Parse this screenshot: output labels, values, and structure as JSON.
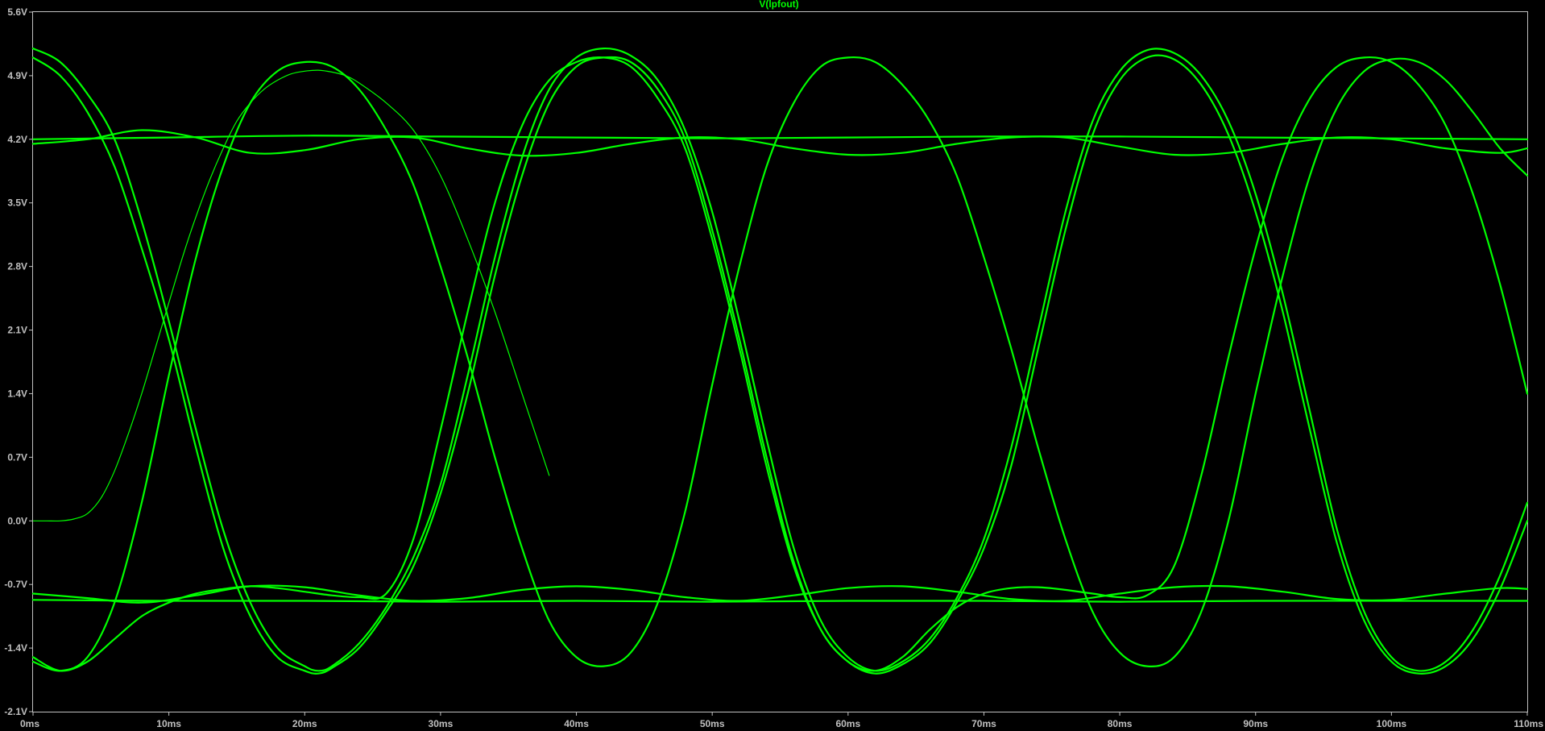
{
  "chart_data": {
    "type": "line",
    "title": "V(lpfout)",
    "xlabel": "",
    "ylabel": "",
    "x_unit": "ms",
    "y_unit": "V",
    "xlim": [
      0,
      110
    ],
    "ylim": [
      -2.1,
      5.6
    ],
    "x_ticks": [
      "0ms",
      "10ms",
      "20ms",
      "30ms",
      "40ms",
      "50ms",
      "60ms",
      "70ms",
      "80ms",
      "90ms",
      "100ms",
      "110ms"
    ],
    "y_ticks": [
      "5.6V",
      "4.9V",
      "4.2V",
      "3.5V",
      "2.8V",
      "2.1V",
      "1.4V",
      "0.7V",
      "0.0V",
      "-0.7V",
      "-1.4V",
      "-2.1V"
    ],
    "grid": false,
    "trace_color": "#00ff00",
    "background_color": "#000000",
    "series": [
      {
        "x": [
          0,
          2,
          4,
          6,
          8,
          10,
          12,
          14,
          16,
          18,
          20,
          21,
          22,
          24,
          26,
          28,
          30,
          32,
          34,
          36,
          38,
          40,
          42,
          44,
          46,
          48,
          50,
          52,
          54,
          56,
          58,
          60,
          62,
          64,
          66,
          68,
          70,
          72,
          74,
          76,
          78,
          80,
          82,
          84,
          86,
          88,
          90,
          92,
          94,
          96,
          98,
          100,
          102,
          104,
          106,
          108,
          110
        ],
        "y": [
          5.2,
          5.05,
          4.7,
          4.2,
          3.3,
          2.2,
          1.0,
          -0.1,
          -0.9,
          -1.4,
          -1.6,
          -1.65,
          -1.6,
          -1.35,
          -0.95,
          -0.4,
          0.4,
          1.6,
          2.9,
          4.0,
          4.75,
          5.1,
          5.2,
          5.12,
          4.85,
          4.3,
          3.4,
          2.2,
          0.9,
          -0.3,
          -1.1,
          -1.5,
          -1.65,
          -1.55,
          -1.3,
          -0.85,
          -0.2,
          0.8,
          2.1,
          3.4,
          4.4,
          4.95,
          5.18,
          5.15,
          4.9,
          4.4,
          3.6,
          2.5,
          1.2,
          -0.1,
          -1.0,
          -1.5,
          -1.65,
          -1.55,
          -1.2,
          -0.6,
          0.2
        ]
      },
      {
        "x": [
          0,
          2,
          4,
          6,
          8,
          10,
          12,
          14,
          16,
          18,
          20,
          21,
          22,
          24,
          26,
          28,
          30,
          32,
          34,
          36,
          38,
          40,
          42,
          44,
          46,
          48,
          50,
          52,
          54,
          56,
          58,
          60,
          62,
          64,
          66,
          68,
          70,
          72,
          74,
          76,
          78,
          80,
          82,
          84,
          86,
          88,
          90,
          92,
          94,
          96,
          98,
          100,
          102,
          104,
          106,
          108,
          110
        ],
        "y": [
          5.1,
          4.9,
          4.5,
          3.9,
          3.0,
          2.0,
          0.8,
          -0.3,
          -1.05,
          -1.5,
          -1.65,
          -1.68,
          -1.62,
          -1.4,
          -1.0,
          -0.5,
          0.3,
          1.4,
          2.7,
          3.8,
          4.6,
          5.0,
          5.1,
          5.05,
          4.75,
          4.2,
          3.2,
          2.0,
          0.7,
          -0.45,
          -1.2,
          -1.55,
          -1.68,
          -1.58,
          -1.35,
          -0.9,
          -0.3,
          0.6,
          1.9,
          3.2,
          4.25,
          4.85,
          5.1,
          5.08,
          4.8,
          4.25,
          3.4,
          2.3,
          1.0,
          -0.25,
          -1.1,
          -1.55,
          -1.68,
          -1.6,
          -1.3,
          -0.75,
          0.0
        ]
      },
      {
        "x": [
          0,
          2,
          4,
          6,
          8,
          10,
          12,
          14,
          16,
          18,
          20,
          22,
          24,
          26,
          28,
          30,
          32,
          34,
          36,
          38,
          40,
          42,
          44,
          46,
          48,
          50,
          52,
          54,
          56,
          58,
          60,
          62,
          64,
          66,
          68,
          70,
          72,
          74,
          76,
          78,
          80,
          82,
          84,
          86,
          88,
          90,
          92,
          94,
          96,
          98,
          100,
          102,
          104,
          106,
          108,
          110
        ],
        "y": [
          -1.55,
          -1.65,
          -1.5,
          -0.9,
          0.2,
          1.6,
          2.9,
          3.9,
          4.6,
          4.95,
          5.05,
          5.0,
          4.75,
          4.3,
          3.7,
          2.8,
          1.8,
          0.7,
          -0.3,
          -1.1,
          -1.5,
          -1.6,
          -1.45,
          -0.9,
          0.1,
          1.5,
          2.8,
          3.9,
          4.6,
          5.0,
          5.1,
          5.05,
          4.8,
          4.4,
          3.8,
          2.9,
          1.9,
          0.8,
          -0.2,
          -1.0,
          -1.45,
          -1.6,
          -1.5,
          -1.0,
          0.0,
          1.4,
          2.7,
          3.8,
          4.55,
          4.95,
          5.08,
          5.05,
          4.85,
          4.5,
          4.1,
          3.8
        ]
      },
      {
        "x": [
          0,
          4,
          8,
          12,
          16,
          20,
          24,
          28,
          32,
          36,
          40,
          44,
          48,
          52,
          56,
          60,
          64,
          68,
          72,
          76,
          80,
          84,
          88,
          92,
          96,
          100,
          104,
          108,
          110
        ],
        "y": [
          4.15,
          4.2,
          4.3,
          4.22,
          4.05,
          4.08,
          4.2,
          4.22,
          4.1,
          4.02,
          4.05,
          4.15,
          4.22,
          4.2,
          4.1,
          4.03,
          4.05,
          4.15,
          4.22,
          4.22,
          4.12,
          4.03,
          4.05,
          4.15,
          4.22,
          4.2,
          4.1,
          4.05,
          4.1
        ]
      },
      {
        "x": [
          0,
          10,
          20,
          30,
          40,
          50,
          60,
          70,
          80,
          90,
          100,
          110
        ],
        "y": [
          4.2,
          4.22,
          4.24,
          4.23,
          4.22,
          4.21,
          4.22,
          4.23,
          4.23,
          4.22,
          4.21,
          4.2
        ]
      },
      {
        "x": [
          0,
          4,
          8,
          12,
          16,
          20,
          24,
          28,
          32,
          36,
          40,
          44,
          48,
          52,
          56,
          60,
          64,
          68,
          72,
          76,
          80,
          84,
          88,
          92,
          96,
          100,
          104,
          108,
          110
        ],
        "y": [
          -0.8,
          -0.85,
          -0.9,
          -0.82,
          -0.72,
          -0.73,
          -0.82,
          -0.88,
          -0.85,
          -0.76,
          -0.72,
          -0.76,
          -0.84,
          -0.88,
          -0.82,
          -0.74,
          -0.72,
          -0.78,
          -0.86,
          -0.88,
          -0.8,
          -0.73,
          -0.72,
          -0.78,
          -0.86,
          -0.87,
          -0.8,
          -0.74,
          -0.75
        ]
      },
      {
        "x": [
          0,
          10,
          20,
          30,
          40,
          50,
          60,
          70,
          80,
          90,
          100,
          110
        ],
        "y": [
          -0.87,
          -0.88,
          -0.88,
          -0.89,
          -0.88,
          -0.89,
          -0.88,
          -0.88,
          -0.89,
          -0.88,
          -0.88,
          -0.88
        ]
      },
      {
        "x": [
          0,
          2,
          4,
          6,
          8,
          10,
          12,
          14,
          16,
          18,
          20,
          22,
          24,
          26,
          28,
          30,
          32,
          34,
          36,
          38,
          40,
          42,
          44,
          46,
          48,
          50,
          52,
          54,
          56,
          58,
          60,
          62,
          64,
          66,
          68,
          70,
          72,
          74,
          76,
          78,
          80,
          82,
          84,
          86,
          88,
          90,
          92,
          94,
          96,
          98,
          100,
          102,
          104,
          106,
          108,
          110
        ],
        "y": [
          -1.5,
          -1.65,
          -1.55,
          -1.3,
          -1.05,
          -0.9,
          -0.8,
          -0.75,
          -0.72,
          -0.74,
          -0.78,
          -0.82,
          -0.84,
          -0.8,
          -0.2,
          1.0,
          2.3,
          3.5,
          4.35,
          4.85,
          5.05,
          5.1,
          5.0,
          4.65,
          4.1,
          3.1,
          1.9,
          0.6,
          -0.5,
          -1.2,
          -1.55,
          -1.65,
          -1.5,
          -1.2,
          -0.95,
          -0.8,
          -0.74,
          -0.73,
          -0.76,
          -0.8,
          -0.84,
          -0.82,
          -0.5,
          0.5,
          1.8,
          3.0,
          4.0,
          4.65,
          5.0,
          5.1,
          5.05,
          4.8,
          4.35,
          3.6,
          2.6,
          1.4
        ]
      },
      {
        "x": [
          0,
          1,
          2,
          3,
          4,
          5,
          6,
          7,
          8,
          9,
          10,
          11,
          12,
          13,
          14,
          15,
          16,
          17,
          18,
          19,
          20,
          21,
          22,
          23,
          24,
          26,
          28,
          30,
          32,
          34,
          36,
          38
        ],
        "y": [
          0,
          0,
          0,
          0.02,
          0.08,
          0.25,
          0.55,
          0.95,
          1.4,
          1.9,
          2.4,
          2.9,
          3.35,
          3.75,
          4.1,
          4.4,
          4.6,
          4.75,
          4.85,
          4.92,
          4.95,
          4.96,
          4.94,
          4.9,
          4.82,
          4.6,
          4.3,
          3.8,
          3.1,
          2.3,
          1.4,
          0.5
        ],
        "thin": true
      }
    ]
  }
}
